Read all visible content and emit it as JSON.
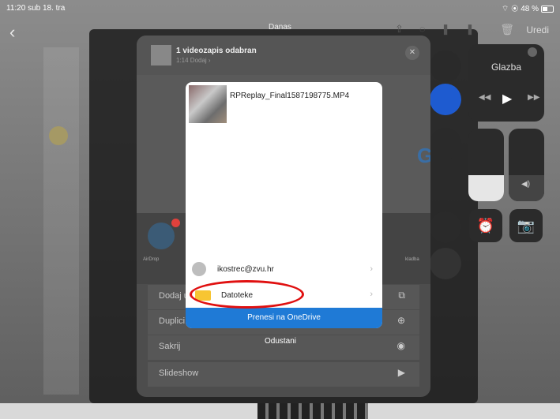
{
  "status_bar": {
    "time": "11:20",
    "date": "sub 18. tra",
    "battery": "48 %"
  },
  "nav": {
    "back": "‹",
    "title": "Danas",
    "edit": "Uredi",
    "trash": "🗑"
  },
  "control_center": {
    "music_label": "Glazba",
    "play": "▶",
    "prev": "◀◀",
    "next": "▶▶",
    "volume_icon": "◀)",
    "alarm_icon": "⏰",
    "camera_icon": "📷"
  },
  "share_sheet": {
    "title": "1 videozapis odabran",
    "subtitle": "1:14  Dodaj ›",
    "close": "✕",
    "google_glyph": "G",
    "airdrop_label": "AirDrop",
    "airdrop_badge": "1",
    "right_app_label": "kladba",
    "actions": [
      {
        "label": "Dodaj u",
        "icon": "⧉"
      },
      {
        "label": "Duplici",
        "icon": "⊕"
      },
      {
        "label": "Sakrij",
        "icon": "◉"
      },
      {
        "label": "Slideshow",
        "icon": "▶"
      }
    ]
  },
  "popup": {
    "filename": "RPReplay_Final1587198775.MP4",
    "account": "ikostrec@zvu.hr",
    "files": "Datoteke",
    "chevron": "›",
    "upload_button": "Prenesi na OneDrive",
    "cancel": "Odustani"
  }
}
